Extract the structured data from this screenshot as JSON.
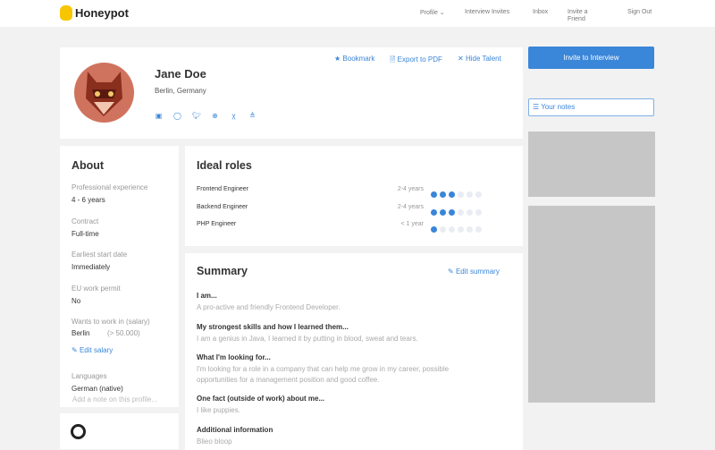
{
  "header": {
    "brand": "Honeypot",
    "nav": [
      "Profile",
      "Interview Invites",
      "Inbox",
      "Invite a Friend",
      "Sign Out"
    ]
  },
  "profile": {
    "name": "Jane Doe",
    "location": "Berlin, Germany",
    "actions": {
      "bookmark": "Bookmark",
      "export": "Export to PDF",
      "hide": "Hide Talent"
    },
    "socials": [
      "linkedin-icon",
      "github-icon",
      "twitter-icon",
      "globe-icon",
      "xing-icon",
      "stackoverflow-icon"
    ]
  },
  "sidebar": {
    "invite": "Invite to Interview",
    "notes": "Your notes"
  },
  "about": {
    "title": "About",
    "items": [
      {
        "label": "Professional experience",
        "value": "4 - 6 years"
      },
      {
        "label": "Contract",
        "value": "Full-time"
      },
      {
        "label": "Earliest start date",
        "value": "Immediately"
      },
      {
        "label": "EU work permit",
        "value": "No"
      }
    ],
    "salary_label": "Wants to work in (salary)",
    "salary_city": "Berlin",
    "salary_amount": "(> 50.000)",
    "edit_salary": "Edit salary",
    "languages_label": "Languages",
    "languages_value": "German (native)",
    "note_placeholder": "Add a note on this profile..."
  },
  "roles": {
    "title": "Ideal roles",
    "items": [
      {
        "name": "Frontend Engineer",
        "exp": "2-4 years",
        "level": 3
      },
      {
        "name": "Backend Engineer",
        "exp": "2-4 years",
        "level": 3
      },
      {
        "name": "PHP Engineer",
        "exp": "< 1 year",
        "level": 1
      }
    ],
    "max": 6
  },
  "summary": {
    "title": "Summary",
    "edit": "Edit summary",
    "sections": [
      {
        "q": "I am...",
        "a": "A pro-active and friendly Frontend Developer."
      },
      {
        "q": "My strongest skills and how I learned them...",
        "a": "I am a genius in Java, I learned it by putting in blood, sweat and tears."
      },
      {
        "q": "What I'm looking for...",
        "a": "I'm looking for a role in a company that can help me grow in my career, possible opportunities for a management position and good coffee."
      },
      {
        "q": "One fact (outside of work) about me...",
        "a": "I like puppies."
      },
      {
        "q": "Additional information",
        "a": "Blieo bloop"
      }
    ]
  }
}
